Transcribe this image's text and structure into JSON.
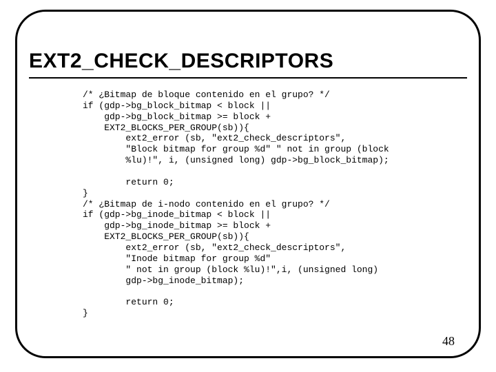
{
  "slide": {
    "title": "EXT2_CHECK_DESCRIPTORS",
    "page_number": "48",
    "code": "/* ¿Bitmap de bloque contenido en el grupo? */\nif (gdp->bg_block_bitmap < block ||\n    gdp->bg_block_bitmap >= block +\n    EXT2_BLOCKS_PER_GROUP(sb)){\n        ext2_error (sb, \"ext2_check_descriptors\",\n        \"Block bitmap for group %d\" \" not in group (block\n        %lu)!\", i, (unsigned long) gdp->bg_block_bitmap);\n\n        return 0;\n}\n/* ¿Bitmap de i-nodo contenido en el grupo? */\nif (gdp->bg_inode_bitmap < block ||\n    gdp->bg_inode_bitmap >= block +\n    EXT2_BLOCKS_PER_GROUP(sb)){\n        ext2_error (sb, \"ext2_check_descriptors\",\n        \"Inode bitmap for group %d\"\n        \" not in group (block %lu)!\",i, (unsigned long)\n        gdp->bg_inode_bitmap);\n\n        return 0;\n}"
  }
}
